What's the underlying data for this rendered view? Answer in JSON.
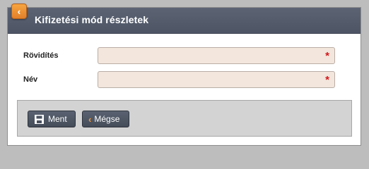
{
  "dialog": {
    "title": "Kifizetési mód részletek",
    "back_icon": "chevron-left-icon"
  },
  "form": {
    "fields": [
      {
        "label": "Rövidítés",
        "value": "",
        "required_mark": "*"
      },
      {
        "label": "Név",
        "value": "",
        "required_mark": "*"
      }
    ]
  },
  "footer": {
    "save_label": "Ment",
    "save_icon": "floppy-disk-icon",
    "cancel_label": "Mégse",
    "cancel_icon": "chevron-left-icon"
  },
  "colors": {
    "header_bg": "#5c6474",
    "accent_orange": "#f0932e",
    "input_bg": "#f3e6dc",
    "required_red": "#d1161b"
  }
}
